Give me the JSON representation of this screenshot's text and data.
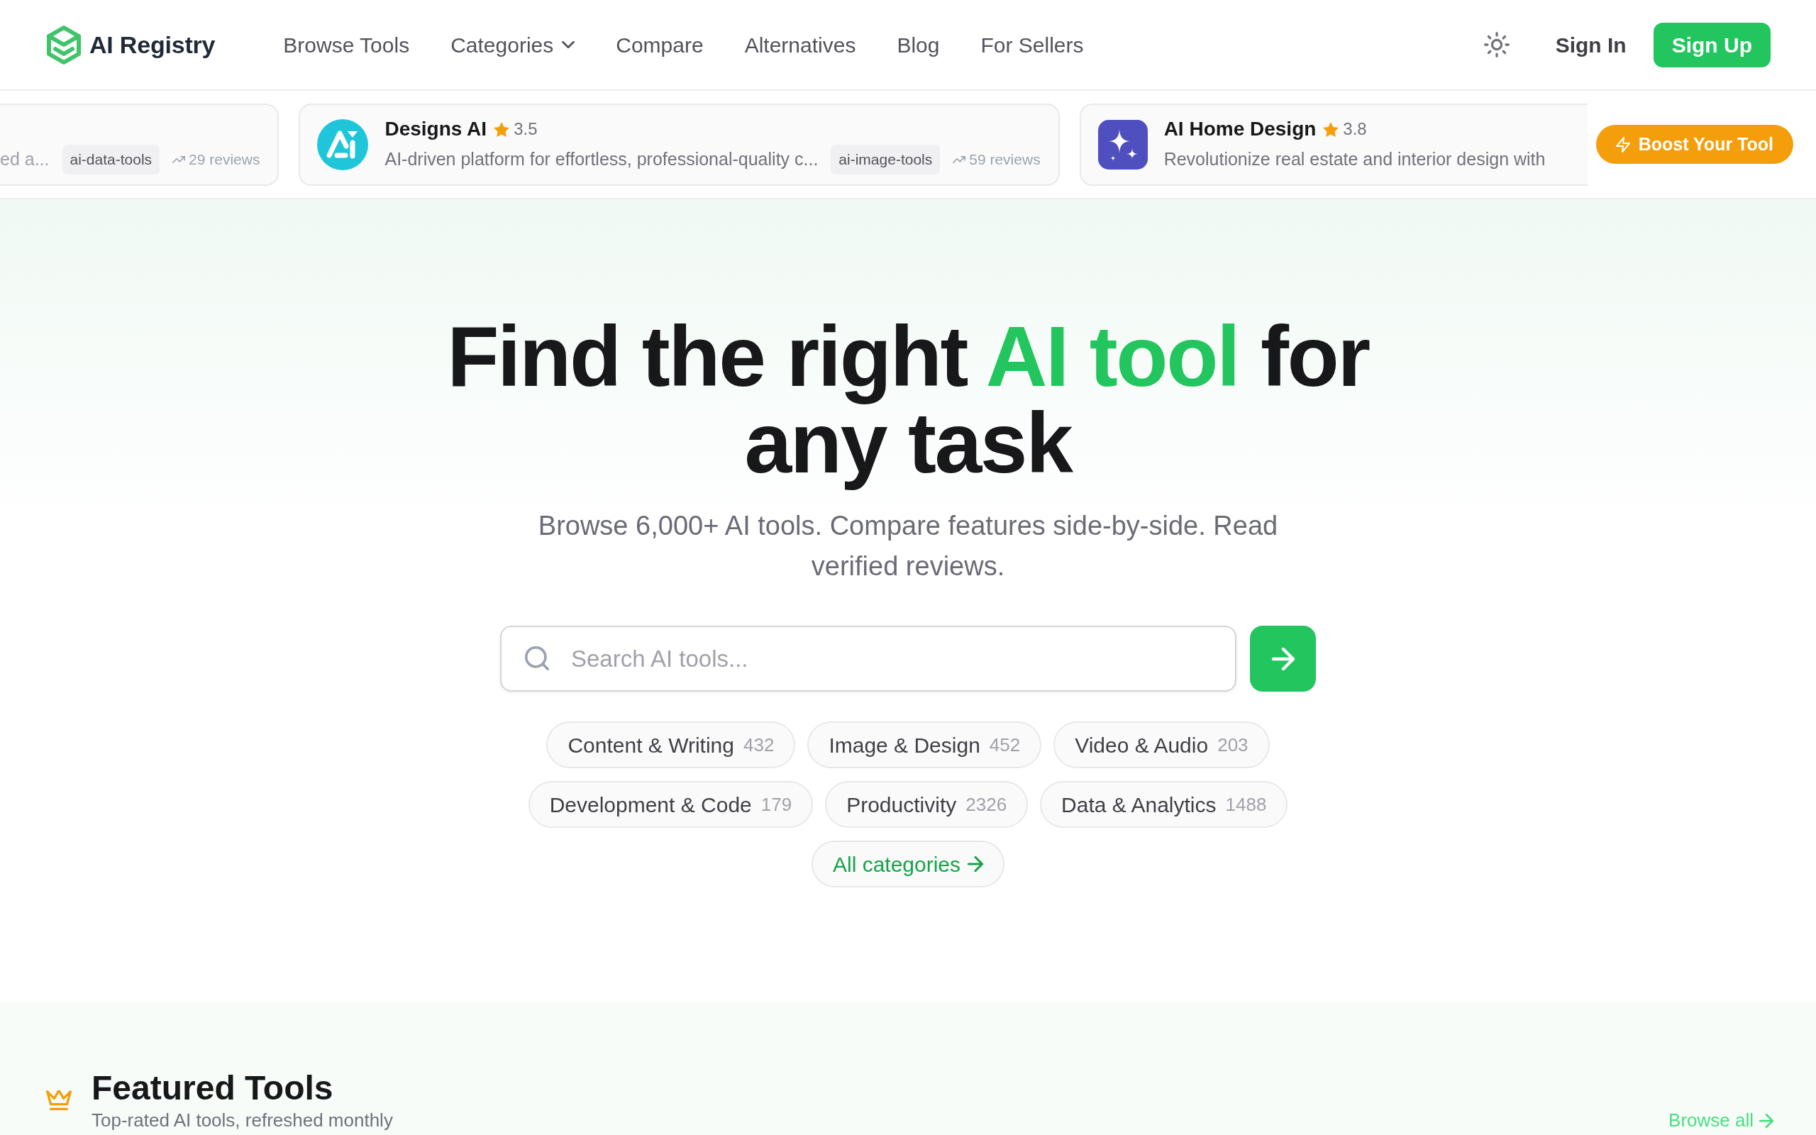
{
  "navbar": {
    "brand": "AI Registry",
    "links": [
      {
        "label": "Browse Tools",
        "dropdown": false
      },
      {
        "label": "Categories",
        "dropdown": true
      },
      {
        "label": "Compare",
        "dropdown": false
      },
      {
        "label": "Alternatives",
        "dropdown": false
      },
      {
        "label": "Blog",
        "dropdown": false
      },
      {
        "label": "For Sellers",
        "dropdown": false
      }
    ],
    "sign_in": "Sign In",
    "sign_up": "Sign Up"
  },
  "ticker": {
    "cards": [
      {
        "description": "ed a...",
        "tag": "ai-data-tools",
        "reviews": "29 reviews"
      },
      {
        "logo": {
          "kind": "monogram"
        },
        "name": "Designs AI",
        "rating": "3.5",
        "description": "AI-driven platform for effortless, professional-quality c...",
        "tag": "ai-image-tools",
        "reviews": "59 reviews"
      },
      {
        "logo": {
          "kind": "sparkles"
        },
        "name": "AI Home Design",
        "rating": "3.8",
        "description": "Revolutionize real estate and interior design with"
      }
    ],
    "boost_button": "Boost Your Tool"
  },
  "hero": {
    "title": [
      {
        "text": "Find the right ",
        "highlight": false
      },
      {
        "text": "AI tool",
        "highlight": true
      },
      {
        "text": " for any task",
        "highlight": false
      }
    ],
    "subtitle": "Browse 6,000+ AI tools. Compare features side-by-side. Read verified reviews.",
    "search": {
      "placeholder": "Search AI tools..."
    },
    "categories": [
      {
        "label": "Content & Writing",
        "count": "432"
      },
      {
        "label": "Image & Design",
        "count": "452"
      },
      {
        "label": "Video & Audio",
        "count": "203"
      },
      {
        "label": "Development & Code",
        "count": "179"
      },
      {
        "label": "Productivity",
        "count": "2326"
      },
      {
        "label": "Data & Analytics",
        "count": "1488"
      }
    ],
    "all_categories": "All categories"
  },
  "featured": {
    "title": "Featured Tools",
    "subtitle": "Top-rated AI tools, refreshed monthly",
    "browse_all": "Browse all"
  }
}
